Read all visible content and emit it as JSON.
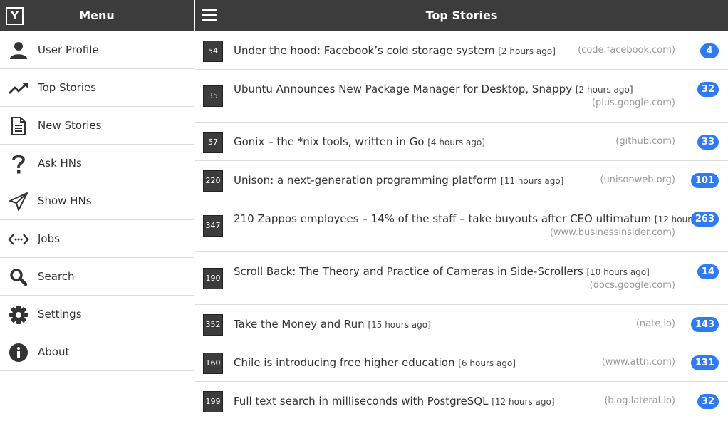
{
  "sidebar": {
    "logo": "Y",
    "title": "Menu",
    "items": [
      {
        "label": "User Profile",
        "icon": "user-icon"
      },
      {
        "label": "Top Stories",
        "icon": "trending-icon"
      },
      {
        "label": "New Stories",
        "icon": "document-icon"
      },
      {
        "label": "Ask HNs",
        "icon": "question-icon"
      },
      {
        "label": "Show HNs",
        "icon": "paper-plane-icon"
      },
      {
        "label": "Jobs",
        "icon": "code-icon"
      },
      {
        "label": "Search",
        "icon": "search-icon"
      },
      {
        "label": "Settings",
        "icon": "gear-icon"
      },
      {
        "label": "About",
        "icon": "info-icon"
      }
    ]
  },
  "header": {
    "title": "Top Stories"
  },
  "colors": {
    "bar": "#3c3c3c",
    "badge": "#2f7bf5"
  },
  "stories": [
    {
      "score": "54",
      "title": "Under the hood: Facebook’s cold storage system",
      "time": "[2 hours ago]",
      "domain": "(code.facebook.com)",
      "comments": "4"
    },
    {
      "score": "35",
      "title": "Ubuntu Announces New Package Manager for Desktop, Snappy",
      "time": "[2 hours ago]",
      "domain": "(plus.google.com)",
      "comments": "32"
    },
    {
      "score": "57",
      "title": "Gonix – the *nix tools, written in Go",
      "time": "[4 hours ago]",
      "domain": "(github.com)",
      "comments": "33"
    },
    {
      "score": "220",
      "title": "Unison: a next-generation programming platform",
      "time": "[11 hours ago]",
      "domain": "(unisonweb.org)",
      "comments": "101"
    },
    {
      "score": "347",
      "title": "210 Zappos employees – 14% of the staff – take buyouts after CEO ultimatum",
      "time": "[12 hours ago]",
      "domain": "(www.businessinsider.com)",
      "comments": "263"
    },
    {
      "score": "190",
      "title": "Scroll Back: The Theory and Practice of Cameras in Side-Scrollers",
      "time": "[10 hours ago]",
      "domain": "(docs.google.com)",
      "comments": "14"
    },
    {
      "score": "352",
      "title": "Take the Money and Run",
      "time": "[15 hours ago]",
      "domain": "(nate.io)",
      "comments": "143"
    },
    {
      "score": "160",
      "title": "Chile is introducing free higher education",
      "time": "[6 hours ago]",
      "domain": "(www.attn.com)",
      "comments": "131"
    },
    {
      "score": "199",
      "title": "Full text search in milliseconds with PostgreSQL",
      "time": "[12 hours ago]",
      "domain": "(blog.lateral.io)",
      "comments": "32"
    }
  ]
}
